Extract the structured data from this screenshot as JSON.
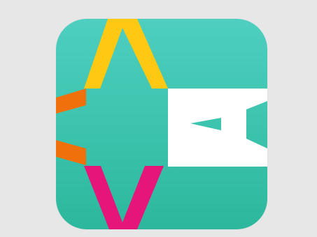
{
  "app_icon": {
    "icon_name": "star-a-logo-icon",
    "colors": {
      "background_top": "#4ecfc0",
      "background_bottom": "#2cb89d",
      "yellow": "#ffc812",
      "orange": "#f0700c",
      "magenta": "#e5157a",
      "white": "#ffffff"
    }
  }
}
